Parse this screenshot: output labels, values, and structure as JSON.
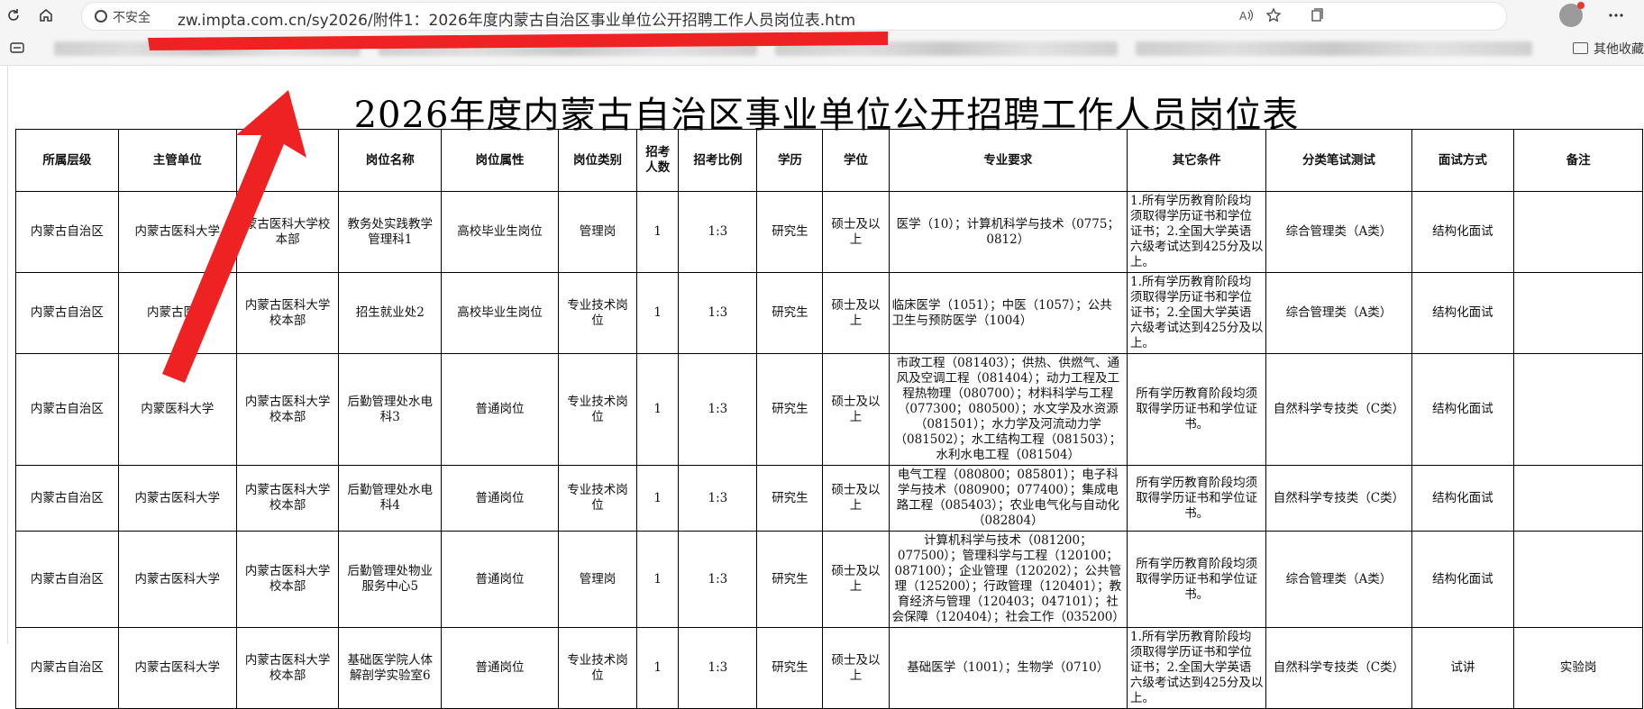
{
  "browser": {
    "security_label": "不安全",
    "url": "zw.impta.com.cn/sy2026/附件1：2026年度内蒙古自治区事业单位公开招聘工作人员岗位表.htm",
    "other_bookmarks": "其他收藏"
  },
  "page": {
    "title": "2026年度内蒙古自治区事业单位公开招聘工作人员岗位表"
  },
  "table": {
    "headers": [
      "所属层级",
      "主管单位",
      "",
      "岗位名称",
      "岗位属性",
      "岗位类别",
      "招考人数",
      "招考比例",
      "学历",
      "学位",
      "专业要求",
      "其它条件",
      "分类笔试测试",
      "面试方式",
      "备注"
    ],
    "rows": [
      [
        "内蒙古自治区",
        "内蒙古医科大学",
        "蒙古医科大学校本部",
        "教务处实践教学管理科1",
        "高校毕业生岗位",
        "管理岗",
        "1",
        "1:3",
        "研究生",
        "硕士及以上",
        "医学（10）；计算机科学与技术（0775；0812）",
        "1.所有学历教育阶段均须取得学历证书和学位证书；2.全国大学英语六级考试达到425分及以上。",
        "综合管理类（A类）",
        "结构化面试",
        ""
      ],
      [
        "内蒙古自治区",
        "内蒙古医科",
        "内蒙古医科大学校本部",
        "招生就业处2",
        "高校毕业生岗位",
        "专业技术岗位",
        "1",
        "1:3",
        "研究生",
        "硕士及以上",
        "临床医学（1051）；中医（1057）；公共卫生与预防医学（1004）",
        "1.所有学历教育阶段均须取得学历证书和学位证书；2.全国大学英语六级考试达到425分及以上。",
        "综合管理类（A类）",
        "结构化面试",
        ""
      ],
      [
        "内蒙古自治区",
        "内蒙医科大学",
        "内蒙古医科大学校本部",
        "后勤管理处水电科3",
        "普通岗位",
        "专业技术岗位",
        "1",
        "1:3",
        "研究生",
        "硕士及以上",
        "市政工程（081403）；供热、供燃气、通风及空调工程（081404）；动力工程及工程热物理（080700）；材料科学与工程（077300；080500）；水文学及水资源（081501）；水力学及河流动力学（081502）；水工结构工程（081503）；水利水电工程（081504）",
        "所有学历教育阶段均须取得学历证书和学位证书。",
        "自然科学专技类（C类）",
        "结构化面试",
        ""
      ],
      [
        "内蒙古自治区",
        "内蒙古医科大学",
        "内蒙古医科大学校本部",
        "后勤管理处水电科4",
        "普通岗位",
        "专业技术岗位",
        "1",
        "1:3",
        "研究生",
        "硕士及以上",
        "电气工程（080800；085801）；电子科学与技术（080900；077400）；集成电路工程（085403）；农业电气化与自动化（082804）",
        "所有学历教育阶段均须取得学历证书和学位证书。",
        "自然科学专技类（C类）",
        "结构化面试",
        ""
      ],
      [
        "内蒙古自治区",
        "内蒙古医科大学",
        "内蒙古医科大学校本部",
        "后勤管理处物业服务中心5",
        "普通岗位",
        "管理岗",
        "1",
        "1:3",
        "研究生",
        "硕士及以上",
        "计算机科学与技术（081200；077500）；管理科学与工程（120100；087100）；企业管理（120202）；公共管理（125200）；行政管理（120401）；教育经济与管理（120403；047101）；社会保障（120404）；社会工作（035200）",
        "所有学历教育阶段均须取得学历证书和学位证书。",
        "综合管理类（A类）",
        "结构化面试",
        ""
      ],
      [
        "内蒙古自治区",
        "内蒙古医科大学",
        "内蒙古医科大学校本部",
        "基础医学院人体解剖学实验室6",
        "普通岗位",
        "专业技术岗位",
        "1",
        "1:3",
        "研究生",
        "硕士及以上",
        "基础医学（1001）；生物学（0710）",
        "1.所有学历教育阶段均须取得学历证书和学位证书；2.全国大学英语六级考试达到425分及以上。",
        "自然科学专技类（C类）",
        "试讲",
        "实验岗"
      ]
    ]
  },
  "colors": {
    "arrow": "#ee2222",
    "chrome": "#f5f5f5",
    "grid": "#000000"
  },
  "icons": [
    "refresh-icon",
    "home-icon",
    "warning-icon",
    "read-aloud-icon",
    "favorite-icon",
    "collections-icon",
    "profile-icon",
    "more-icon",
    "tab-actions-icon",
    "folder-icon"
  ]
}
